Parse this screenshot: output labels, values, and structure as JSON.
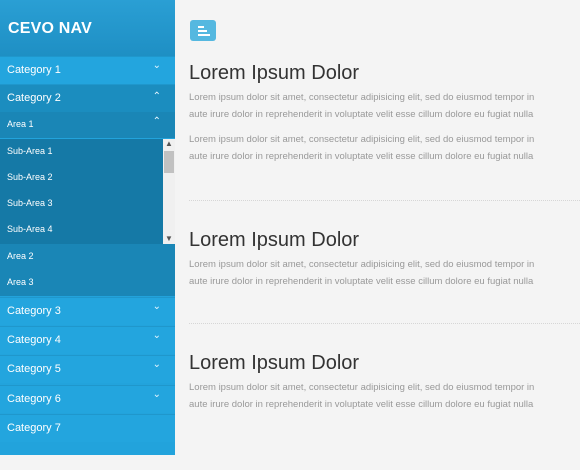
{
  "brand": "CEVO NAV",
  "sidebar": {
    "category1": "Category 1",
    "category2": "Category 2",
    "area1": "Area 1",
    "subareas": [
      "Sub-Area 1",
      "Sub-Area 2",
      "Sub-Area 3",
      "Sub-Area 4"
    ],
    "area2": "Area 2",
    "area3": "Area 3",
    "category3": "Category 3",
    "category4": "Category 4",
    "category5": "Category 5",
    "category6": "Category 6",
    "category7": "Category 7"
  },
  "icons": {
    "menu": "menu-icon",
    "chevron_down": "chevron-down-icon",
    "chevron_up": "chevron-up-icon"
  },
  "main": {
    "sections": [
      {
        "title": "Lorem Ipsum Dolor",
        "para1_line1": "Lorem ipsum dolor sit amet, consectetur adipisicing elit, sed do eiusmod tempor in",
        "para1_line2": "aute irure dolor in reprehenderit in voluptate velit esse cillum dolore eu fugiat nulla",
        "para2_line1": "Lorem ipsum dolor sit amet, consectetur adipisicing elit, sed do eiusmod tempor in",
        "para2_line2": "aute irure dolor in reprehenderit in voluptate velit esse cillum dolore eu fugiat nulla"
      },
      {
        "title": "Lorem Ipsum Dolor",
        "para1_line1": "Lorem ipsum dolor sit amet, consectetur adipisicing elit, sed do eiusmod tempor in",
        "para1_line2": "aute irure dolor in reprehenderit in voluptate velit esse cillum dolore eu fugiat nulla"
      },
      {
        "title": "Lorem Ipsum Dolor",
        "para1_line1": "Lorem ipsum dolor sit amet, consectetur adipisicing elit, sed do eiusmod tempor in",
        "para1_line2": "aute irure dolor in reprehenderit in voluptate velit esse cillum dolore eu fugiat nulla"
      }
    ]
  },
  "colors": {
    "sidebar": "#22a3dc",
    "accent": "#55b8e0"
  }
}
